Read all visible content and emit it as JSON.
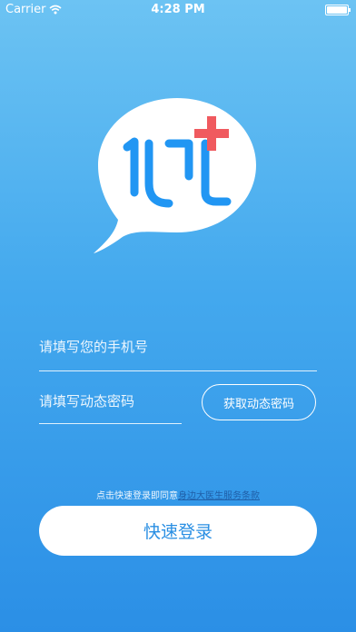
{
  "status_bar": {
    "carrier": "Carrier",
    "time": "4:28 PM"
  },
  "form": {
    "phone_placeholder": "请填写您的手机号",
    "code_placeholder": "请填写动态密码",
    "get_code_label": "获取动态密码"
  },
  "agreement": {
    "prefix": "点击快速登录即同意",
    "link": "身边大医生服务条款"
  },
  "login_label": "快速登录",
  "colors": {
    "primary_blue": "#2196f3",
    "accent_red": "#f05a5f",
    "link_blue": "#1f5fa8"
  },
  "icons": [
    "wifi-icon",
    "battery-icon",
    "app-logo-speech-bubble",
    "medical-cross-icon"
  ]
}
